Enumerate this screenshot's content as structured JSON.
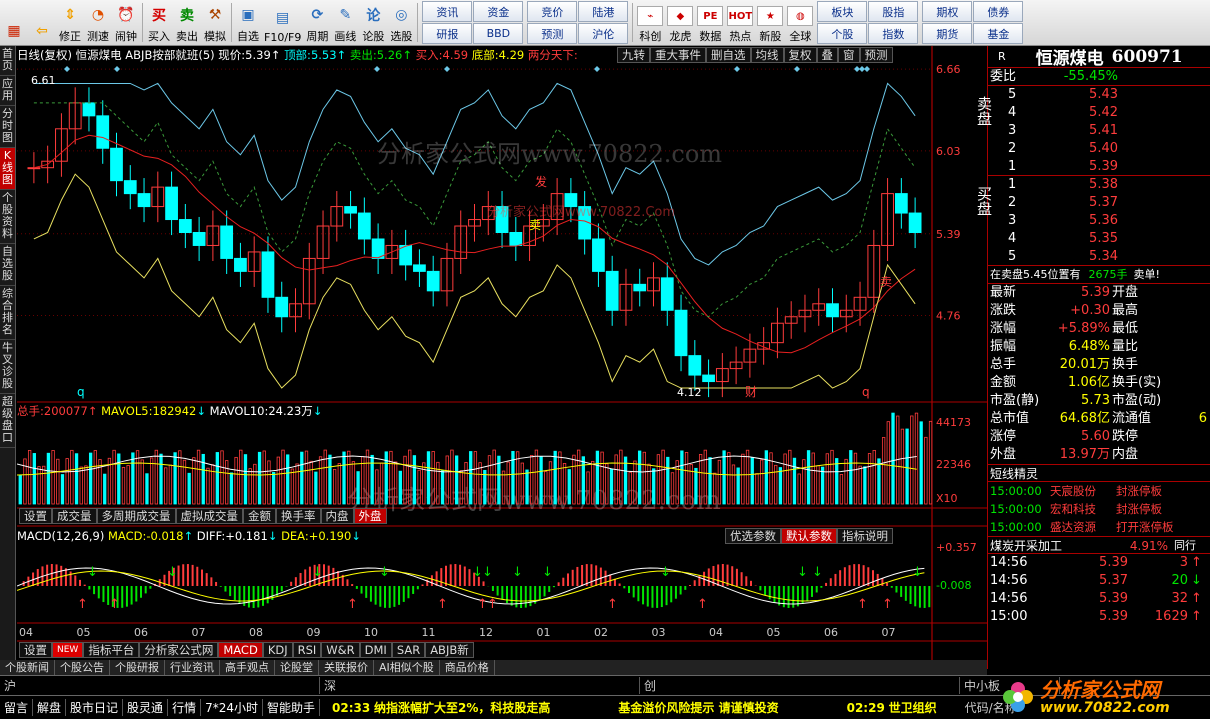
{
  "toolbar": {
    "buttons": [
      {
        "label": "",
        "icon": "grid-icon",
        "color": "#cc2200"
      },
      {
        "label": "",
        "icon": "back-arrow-icon",
        "color": "#f0a000"
      },
      {
        "label": "修正",
        "icon": "up-down-arrows-icon",
        "color": "#f0a000"
      },
      {
        "label": "测速",
        "icon": "speedometer-icon",
        "color": "#e05000"
      },
      {
        "label": "闹钟",
        "icon": "alarm-clock-icon",
        "color": "#333"
      },
      {
        "label": "买入",
        "icon": "buy-icon",
        "color": "#d40000",
        "glyph": "买"
      },
      {
        "label": "卖出",
        "icon": "sell-icon",
        "color": "#008800",
        "glyph": "卖"
      },
      {
        "label": "模拟",
        "icon": "hammer-icon",
        "color": "#aa4400"
      },
      {
        "label": "自选",
        "icon": "folder-icon",
        "color": "#2a6ebd"
      },
      {
        "label": "F10/F9",
        "icon": "document-icon",
        "color": "#2a6ebd"
      },
      {
        "label": "周期",
        "icon": "cycle-icon",
        "color": "#2a6ebd"
      },
      {
        "label": "画线",
        "icon": "pencil-icon",
        "color": "#2a6ebd"
      },
      {
        "label": "论股",
        "icon": "discuss-icon",
        "color": "#2a6ebd",
        "glyph": "论"
      },
      {
        "label": "选股",
        "icon": "chart-pick-icon",
        "color": "#2a6ebd"
      }
    ],
    "grid1": [
      "资讯",
      "资金",
      "研报",
      "BBD"
    ],
    "grid2": [
      "竞价",
      "陆港",
      "预测",
      "沪伦"
    ],
    "buttons2": [
      {
        "label": "科创",
        "icon": "kechuang-icon"
      },
      {
        "label": "龙虎",
        "icon": "dragon-tiger-icon"
      },
      {
        "label": "数据",
        "icon": "pe-icon",
        "glyph": "PE"
      },
      {
        "label": "热点",
        "icon": "hot-icon",
        "glyph": "HOT"
      },
      {
        "label": "新股",
        "icon": "new-stock-icon"
      },
      {
        "label": "全球",
        "icon": "globe-icon"
      }
    ],
    "grid3": [
      "板块",
      "股指",
      "个股",
      "指数"
    ],
    "grid4": [
      "期权",
      "债券",
      "期货",
      "基金"
    ]
  },
  "leftbar": {
    "items": [
      "首页",
      "应用",
      "分时图",
      "K线图",
      "个股资料",
      "自选股",
      "综合排名",
      "牛叉诊股",
      "超级盘口"
    ],
    "active": "K线图"
  },
  "chart": {
    "header": {
      "title": "日线(复权)",
      "name": "恒源煤电",
      "indicator": "ABJB按部就班(5)",
      "price_label": "现价:",
      "price": "5.39",
      "top_label": "顶部:",
      "top": "5.53",
      "sell_label": "卖出:",
      "sell": "5.26",
      "buy_label": "买入:",
      "buy": "4.59",
      "bottom_label": "底部:",
      "bottom": "4.29",
      "extra": "两分天下:"
    },
    "toptabs": [
      "九转",
      "重大事件",
      "删自选",
      "均线",
      "复权",
      "叠",
      "窗",
      "预测"
    ],
    "price_axis": [
      "6.66",
      "6.03",
      "5.39",
      "4.76"
    ],
    "marks": {
      "high": "6.61",
      "low": "4.12",
      "cai": "财",
      "q1": "q",
      "q2": "q",
      "fa": "发",
      "mai": "卖",
      "mai2": "卖",
      "watermark": "分析家公式网www.70822.com",
      "watermark2": "分析家公式网www.70822.Com",
      "watermark3": "分析家公式网www.70822.com"
    },
    "vol": {
      "label": "总手:",
      "value": "200077",
      "ma5_label": "MAVOL5:",
      "ma5": "182942",
      "ma10_label": "MAVOL10:",
      "ma10": "24.23万",
      "axis": [
        "44173",
        "22346",
        "X10"
      ]
    },
    "subtabs": [
      "设置",
      "成交量",
      "多周期成交量",
      "虚拟成交量",
      "金额",
      "换手率",
      "内盘",
      "外盘"
    ],
    "active_subtab": "外盘",
    "macd": {
      "label": "MACD(12,26,9)",
      "macd_label": "MACD:",
      "macd": "-0.018",
      "diff_label": "DIFF:",
      "diff": "+0.181",
      "dea_label": "DEA:",
      "dea": "+0.190",
      "axis": [
        "+0.357",
        "-0.008"
      ],
      "buttons": [
        "优选参数",
        "默认参数",
        "指标说明"
      ]
    },
    "months": [
      "04",
      "05",
      "06",
      "07",
      "08",
      "09",
      "10",
      "11",
      "12",
      "01",
      "02",
      "03",
      "04",
      "05",
      "06",
      "07"
    ],
    "bottom_tabs": [
      "设置",
      "NEW",
      "指标平台",
      "分析家公式网",
      "MACD",
      "KDJ",
      "RSI",
      "W&R",
      "DMI",
      "SAR",
      "ABJB新"
    ],
    "active_bottom_tab": "MACD"
  },
  "chart_data": {
    "type": "candlestick",
    "title": "恒源煤电 日线(复权)",
    "ylim": [
      4.1,
      6.7
    ],
    "price_ticks": [
      6.66,
      6.03,
      5.39,
      4.76
    ],
    "high": 6.61,
    "low": 4.12,
    "last": 5.39,
    "months": [
      "04",
      "05",
      "06",
      "07",
      "08",
      "09",
      "10",
      "11",
      "12",
      "01",
      "02",
      "03",
      "04",
      "05",
      "06",
      "07"
    ],
    "close_series": [
      5.9,
      5.95,
      6.2,
      6.4,
      6.3,
      6.05,
      5.8,
      5.7,
      5.6,
      5.75,
      5.5,
      5.4,
      5.3,
      5.45,
      5.2,
      5.1,
      5.25,
      4.9,
      4.75,
      4.85,
      5.2,
      5.45,
      5.6,
      5.55,
      5.35,
      5.2,
      5.3,
      5.15,
      5.1,
      4.95,
      5.2,
      5.45,
      5.5,
      5.6,
      5.4,
      5.3,
      5.45,
      5.5,
      5.7,
      5.6,
      5.35,
      5.1,
      4.8,
      5.0,
      4.95,
      5.05,
      4.8,
      4.45,
      4.3,
      4.25,
      4.35,
      4.4,
      4.5,
      4.55,
      4.7,
      4.75,
      4.8,
      4.85,
      4.75,
      4.8,
      4.9,
      5.3,
      5.7,
      5.55,
      5.4
    ],
    "macd_axis": [
      0.357,
      -0.008
    ],
    "vol_axis": [
      44173,
      22346
    ]
  },
  "right": {
    "name": "恒源煤电",
    "code": "600971",
    "r": "R",
    "wb_label": "委比",
    "wb": "-55.45%",
    "sell_label": "卖盘",
    "sells": [
      [
        "5",
        "5.43"
      ],
      [
        "4",
        "5.42"
      ],
      [
        "3",
        "5.41"
      ],
      [
        "2",
        "5.40"
      ],
      [
        "1",
        "5.39"
      ]
    ],
    "buy_label": "买盘",
    "buys": [
      [
        "1",
        "5.38"
      ],
      [
        "2",
        "5.37"
      ],
      [
        "3",
        "5.36"
      ],
      [
        "4",
        "5.35"
      ],
      [
        "5",
        "5.34"
      ]
    ],
    "notice": "在卖盘5.45位置有",
    "notice_vol": "2675手",
    "notice_tail": "卖单!",
    "quote": [
      [
        "最新",
        "5.39",
        "开盘",
        ""
      ],
      [
        "涨跌",
        "+0.30",
        "最高",
        ""
      ],
      [
        "涨幅",
        "+5.89%",
        "最低",
        ""
      ],
      [
        "振幅",
        "6.48%",
        "量比",
        ""
      ],
      [
        "总手",
        "20.01万",
        "换手",
        ""
      ],
      [
        "金额",
        "1.06亿",
        "换手(实)",
        ""
      ],
      [
        "市盈(静)",
        "5.73",
        "市盈(动)",
        ""
      ],
      [
        "总市值",
        "64.68亿",
        "流通值",
        "6"
      ],
      [
        "涨停",
        "5.60",
        "跌停",
        ""
      ],
      [
        "外盘",
        "13.97万",
        "内盘",
        ""
      ]
    ],
    "short_title": "短线精灵",
    "short": [
      [
        "15:00:00",
        "天宸股份",
        "封涨停板"
      ],
      [
        "15:00:00",
        "宏和科技",
        "封涨停板"
      ],
      [
        "15:00:00",
        "盛达资源",
        "打开涨停板"
      ]
    ],
    "sector": "煤炭开采加工",
    "sector_pct": "4.91%",
    "sector_tail": "同行",
    "ticks": [
      [
        "14:56",
        "5.39",
        "3",
        "up"
      ],
      [
        "14:56",
        "5.37",
        "20",
        "down"
      ],
      [
        "14:56",
        "5.39",
        "32",
        "up"
      ],
      [
        "15:00",
        "5.39",
        "1629",
        "up"
      ]
    ]
  },
  "bottom": {
    "row1": [
      "个股新闻",
      "个股公告",
      "个股研报",
      "行业资讯",
      "高手观点",
      "论股堂",
      "关联报价",
      "AI相似个股",
      "商品价格"
    ],
    "row2_markets": [
      "沪",
      "深",
      "创",
      "中小板"
    ],
    "row3": [
      "留言",
      "解盘",
      "股市日记",
      "股灵通",
      "行情",
      "7*24小时",
      "智能助手"
    ],
    "news1_time": "02:33",
    "news1": "纳指涨幅扩大至2%，科技股走高",
    "news2": "基金溢价风险提示 请谨慎投资",
    "news3_time": "02:29",
    "news3": "世卫组织",
    "tail": "代码/名称",
    "logo": "分析家公式网",
    "logo_url": "www.70822.com"
  },
  "colors": {
    "up": "#ff3c3c",
    "down": "#00e600",
    "bg": "#000000",
    "axis": "#cc0000",
    "ma_red": "#e82020",
    "ma_cyan": "#6cc8e8",
    "ma_yellow": "#e8e060",
    "ma_green": "#3a9a3a"
  }
}
